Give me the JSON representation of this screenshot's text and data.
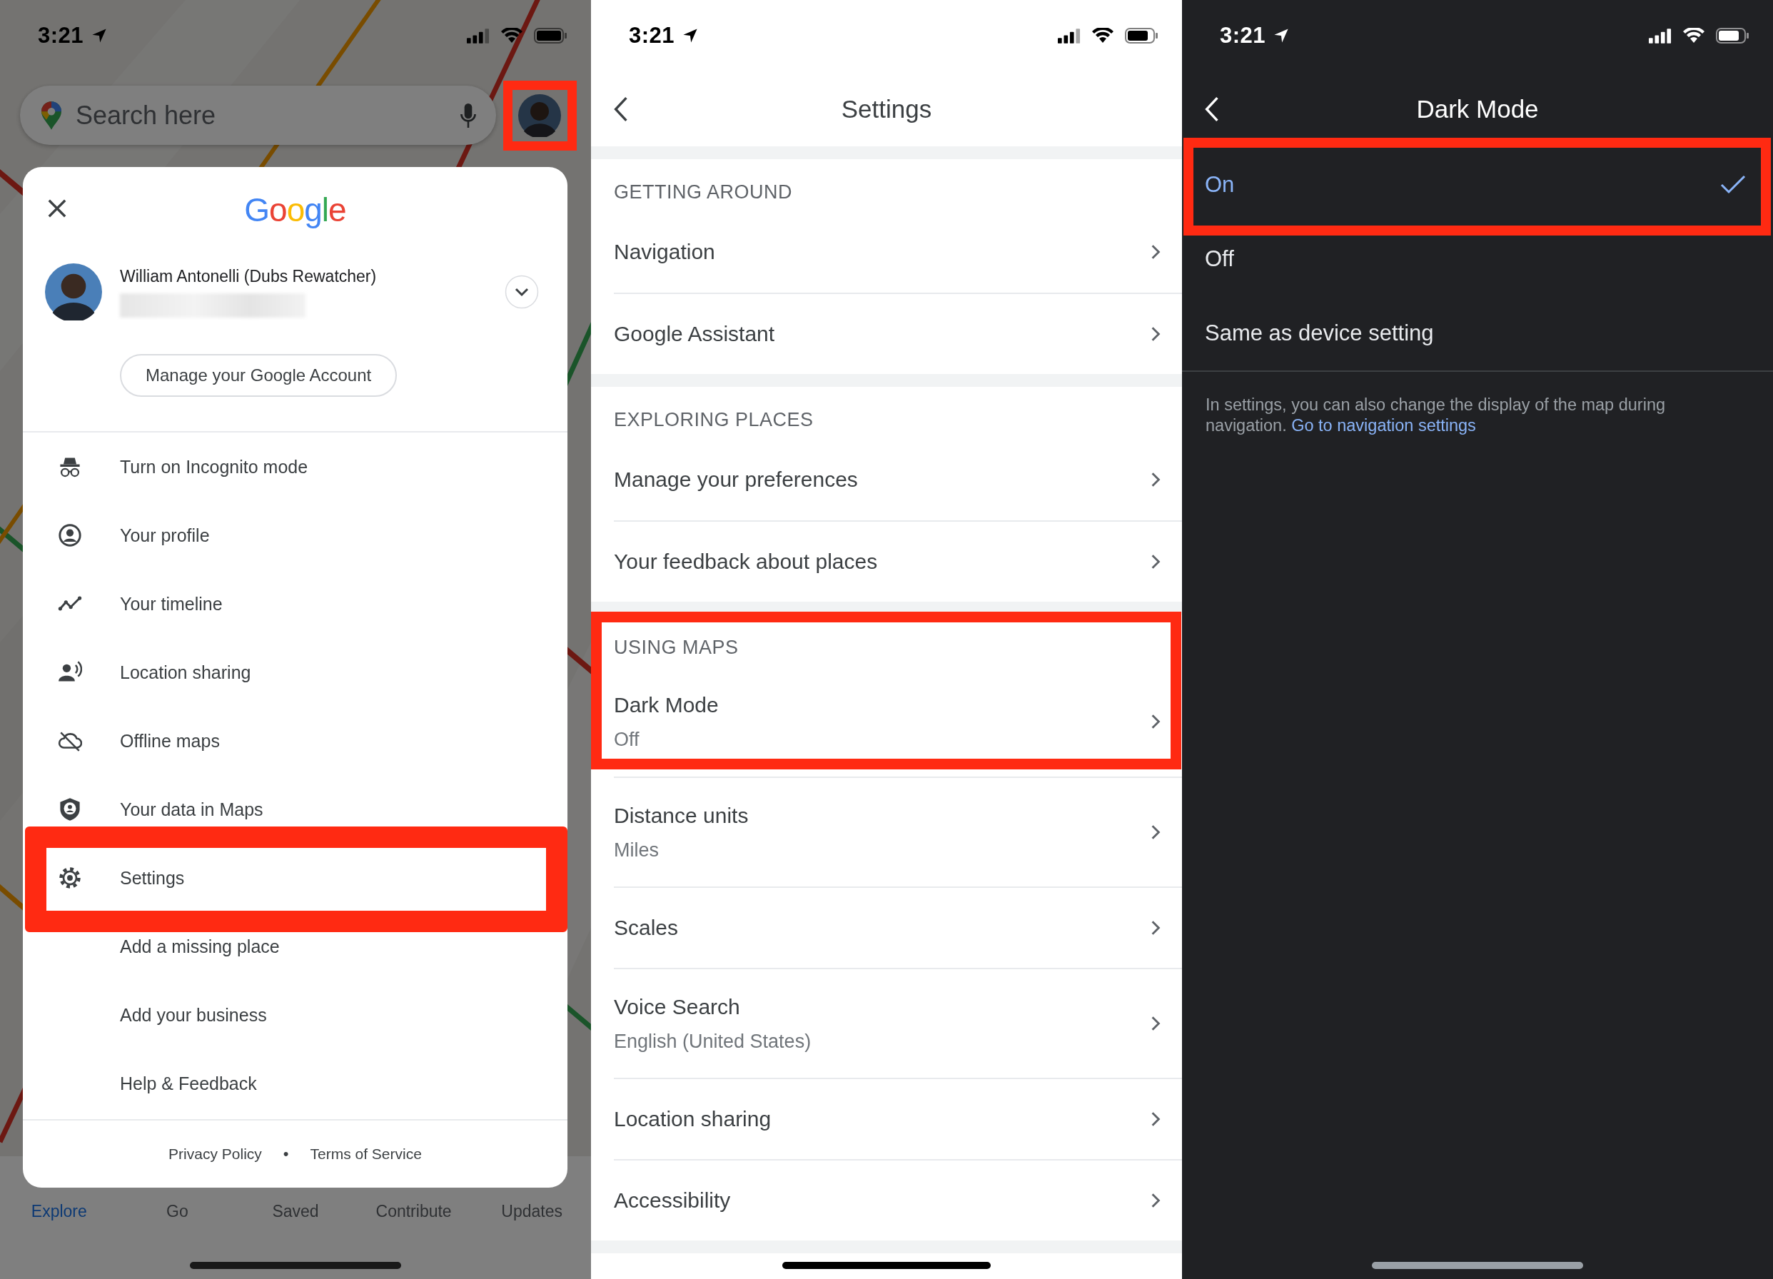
{
  "maps_home": {
    "status_bar": {
      "time": "3:21"
    },
    "search": {
      "placeholder": "Search here"
    },
    "account_avatar": {
      "highlighted": true
    },
    "bottom_tabs": [
      {
        "label": "Explore",
        "selected": true
      },
      {
        "label": "Go",
        "selected": false
      },
      {
        "label": "Saved",
        "selected": false
      },
      {
        "label": "Contribute",
        "selected": false
      },
      {
        "label": "Updates",
        "selected": false
      }
    ],
    "account_menu": {
      "logo": "Google",
      "account_name": "William Antonelli (Dubs Rewatcher)",
      "manage_button": "Manage your Google Account",
      "items": [
        {
          "label": "Turn on Incognito mode",
          "kind": "incognito",
          "highlighted": false
        },
        {
          "label": "Your profile",
          "kind": "profile",
          "highlighted": false
        },
        {
          "label": "Your timeline",
          "kind": "timeline",
          "highlighted": false
        },
        {
          "label": "Location sharing",
          "kind": "sharing",
          "highlighted": false
        },
        {
          "label": "Offline maps",
          "kind": "offline",
          "highlighted": false
        },
        {
          "label": "Your data in Maps",
          "kind": "shield",
          "highlighted": false
        },
        {
          "label": "Settings",
          "kind": "settings",
          "highlighted": true
        },
        {
          "label": "Add a missing place",
          "kind": "plain",
          "highlighted": false
        },
        {
          "label": "Add your business",
          "kind": "plain",
          "highlighted": false
        },
        {
          "label": "Help & Feedback",
          "kind": "plain",
          "highlighted": false
        }
      ],
      "footer_links": [
        "Privacy Policy",
        "Terms of Service"
      ],
      "footer_separator": "•"
    }
  },
  "settings": {
    "status_bar": {
      "time": "3:21"
    },
    "title": "Settings",
    "sections": [
      {
        "heading": "GETTING AROUND",
        "items": [
          {
            "label": "Navigation",
            "highlighted": false
          },
          {
            "label": "Google Assistant",
            "highlighted": false
          }
        ]
      },
      {
        "heading": "EXPLORING PLACES",
        "items": [
          {
            "label": "Manage your preferences",
            "highlighted": false
          },
          {
            "label": "Your feedback about places",
            "highlighted": false
          }
        ]
      },
      {
        "heading": "USING MAPS",
        "items": [
          {
            "label": "Dark Mode",
            "value": "Off",
            "highlighted": true
          },
          {
            "label": "Distance units",
            "value": "Miles",
            "highlighted": false
          },
          {
            "label": "Scales",
            "highlighted": false
          },
          {
            "label": "Voice Search",
            "value": "English (United States)",
            "highlighted": false
          },
          {
            "label": "Location sharing",
            "highlighted": false
          },
          {
            "label": "Accessibility",
            "highlighted": false
          }
        ]
      }
    ]
  },
  "dark_mode": {
    "status_bar": {
      "time": "3:21"
    },
    "title": "Dark Mode",
    "options": [
      {
        "label": "On",
        "selected": true,
        "highlighted": true
      },
      {
        "label": "Off",
        "selected": false,
        "highlighted": false
      },
      {
        "label": "Same as device setting",
        "selected": false,
        "highlighted": false
      }
    ],
    "note": {
      "text": "In settings, you can also change the display of the map during navigation.",
      "link": "Go to navigation settings"
    }
  }
}
